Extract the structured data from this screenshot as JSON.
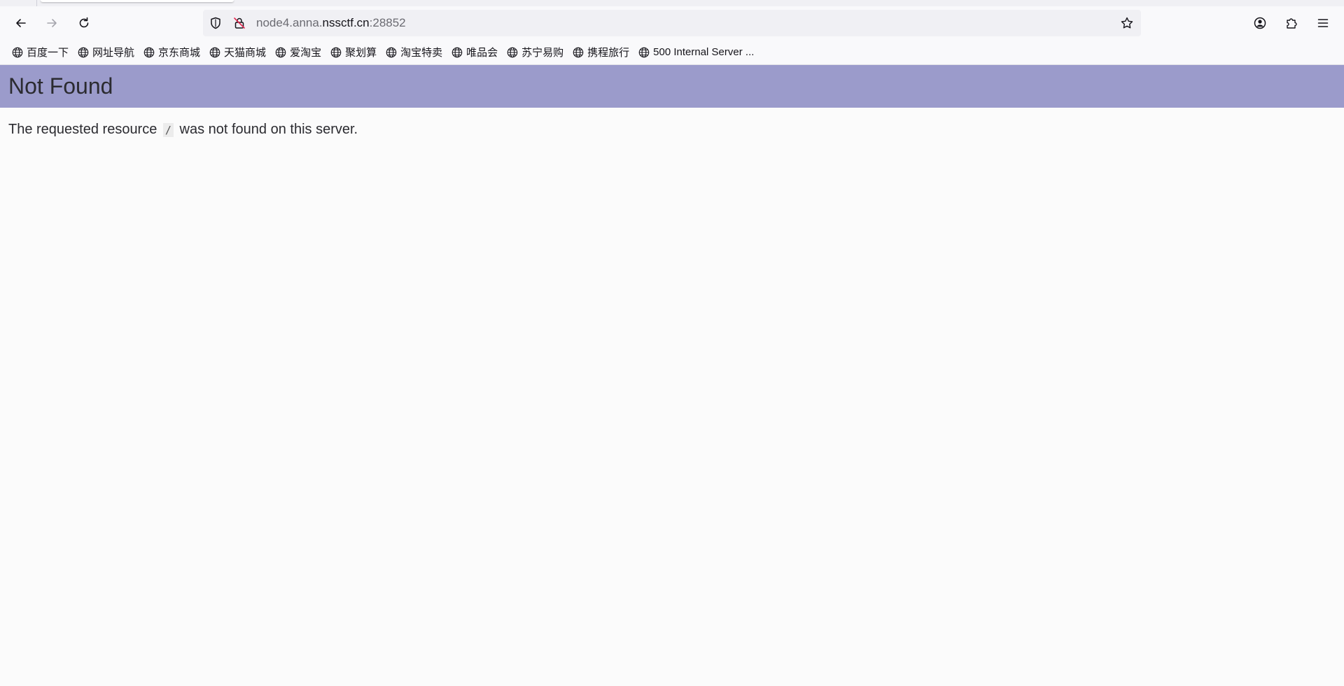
{
  "browser": {
    "url": {
      "prefix": "node4.anna.",
      "domain": "nssctf.cn",
      "suffix": ":28852"
    },
    "bookmarks": [
      {
        "label": "百度一下",
        "icon": "globe-icon"
      },
      {
        "label": "网址导航",
        "icon": "globe-icon"
      },
      {
        "label": "京东商城",
        "icon": "globe-icon"
      },
      {
        "label": "天猫商城",
        "icon": "globe-icon"
      },
      {
        "label": "爱淘宝",
        "icon": "globe-icon"
      },
      {
        "label": "聚划算",
        "icon": "globe-icon"
      },
      {
        "label": "淘宝特卖",
        "icon": "globe-icon"
      },
      {
        "label": "唯品会",
        "icon": "globe-icon"
      },
      {
        "label": "苏宁易购",
        "icon": "globe-icon"
      },
      {
        "label": "携程旅行",
        "icon": "globe-icon"
      },
      {
        "label": "500 Internal Server ...",
        "icon": "globe-icon"
      }
    ]
  },
  "page": {
    "header_color": "#9b9bcb",
    "title": "Not Found",
    "message_before": "The requested resource",
    "resource": "/",
    "message_after": "was not found on this server."
  }
}
